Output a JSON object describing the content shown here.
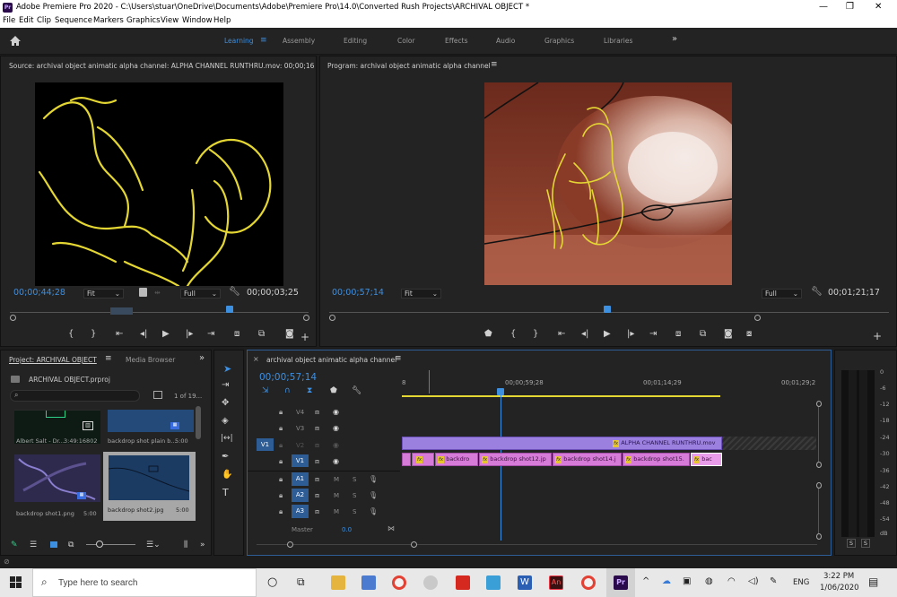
{
  "window": {
    "title": "Adobe Premiere Pro 2020 - C:\\Users\\stuar\\OneDrive\\Documents\\Adobe\\Premiere Pro\\14.0\\Converted Rush Projects\\ARCHIVAL OBJECT *",
    "app_icon": "Pr"
  },
  "menu": [
    "File",
    "Edit",
    "Clip",
    "Sequence",
    "Markers",
    "Graphics",
    "View",
    "Window",
    "Help"
  ],
  "workspaces": {
    "items": [
      "Learning",
      "Assembly",
      "Editing",
      "Color",
      "Effects",
      "Audio",
      "Graphics",
      "Libraries"
    ],
    "active": "Learning",
    "more": "»"
  },
  "source": {
    "title": "Source: archival object animatic alpha channel: ALPHA CHANNEL RUNTHRU.mov: 00;00;16",
    "timecode_left": "00;00;44;28",
    "fit": "Fit",
    "quality": "Full",
    "timecode_right": "00;00;03;25"
  },
  "program": {
    "title": "Program: archival object animatic alpha channel",
    "timecode_left": "00;00;57;14",
    "fit": "Fit",
    "quality": "Full",
    "timecode_right": "00;01;21;17"
  },
  "project": {
    "tab_active": "Project: ARCHIVAL OBJECT",
    "tab_other": "Media Browser",
    "more": "»",
    "file": "ARCHIVAL OBJECT.prproj",
    "count": "1 of 19...",
    "items": [
      {
        "name": "Albert Salt - Dr...",
        "duration": "3:49:16802"
      },
      {
        "name": "backdrop shot plain b...",
        "duration": "5:00"
      },
      {
        "name": "backdrop shot1.png",
        "duration": "5:00"
      },
      {
        "name": "backdrop shot2.jpg",
        "duration": "5:00"
      }
    ]
  },
  "timeline": {
    "title": "archival object animatic alpha channel",
    "timecode": "00;00;57;14",
    "ruler": [
      "00;00;59;28",
      "00;01;14;29",
      "00;01;29;2"
    ],
    "ruler_first": "8",
    "video_tracks": [
      "V4",
      "V3",
      "V2",
      "V1"
    ],
    "audio_tracks": [
      "A1",
      "A2",
      "A3"
    ],
    "source_patch": "V1",
    "master_label": "Master",
    "master_value": "0.0",
    "v2_clip": "ALPHA CHANNEL RUNTHRU.mov",
    "v1_clips": [
      "backdro",
      "backdrop shot12.jp",
      "backdrop shot14.j",
      "backdrop shot15.",
      "bac"
    ],
    "m_label": "M",
    "s_label": "S"
  },
  "meter": {
    "scale": [
      "0",
      "-6",
      "-12",
      "-18",
      "-24",
      "-30",
      "-36",
      "-42",
      "-48",
      "-54",
      "dB"
    ],
    "solo": [
      "S",
      "S"
    ]
  },
  "taskbar": {
    "search_placeholder": "Type here to search",
    "lang": "ENG",
    "time": "3:22 PM",
    "date": "1/06/2020"
  }
}
